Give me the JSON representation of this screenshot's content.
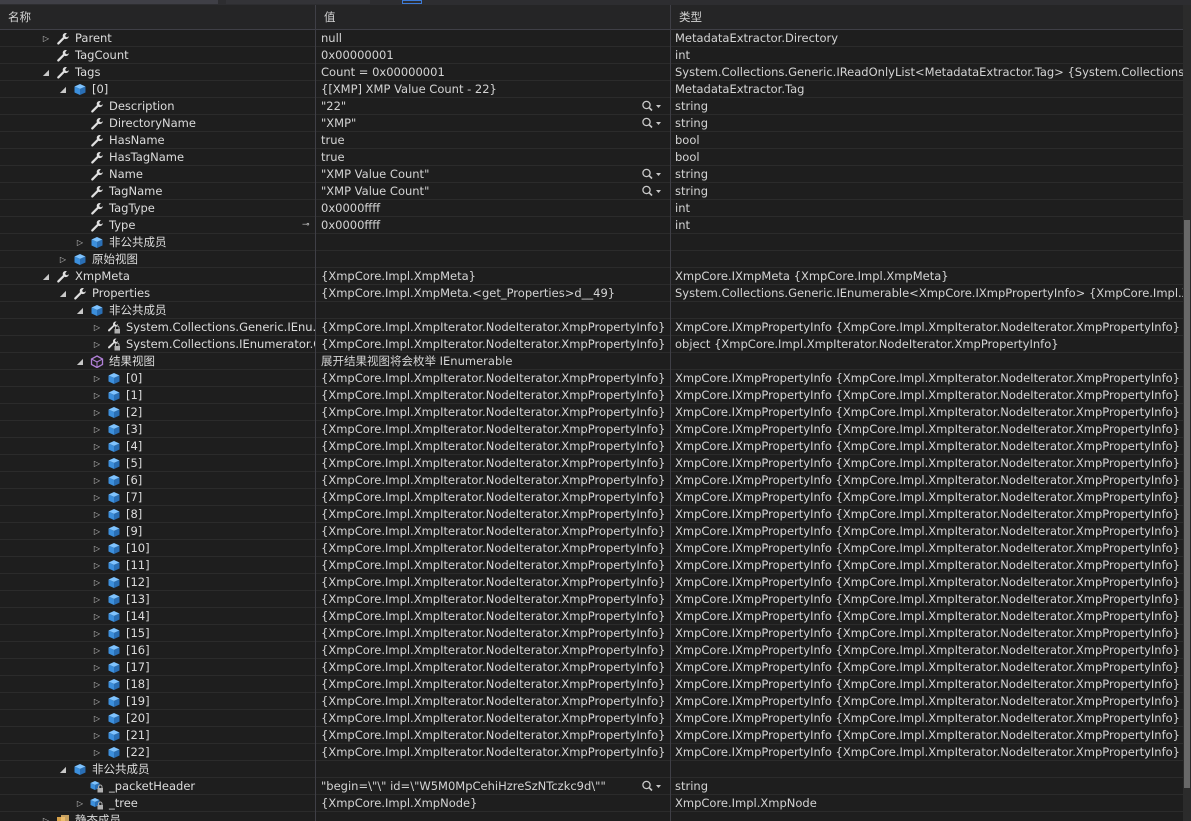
{
  "header": {
    "name": "名称",
    "value": "值",
    "type": "类型"
  },
  "rows": [
    {
      "indent": 41,
      "exp": "right",
      "icon": "wrench",
      "name": "Parent",
      "value": "null",
      "type": "MetadataExtractor.Directory"
    },
    {
      "indent": 41,
      "exp": "",
      "icon": "wrench",
      "name": "TagCount",
      "value": "0x00000001",
      "type": "int"
    },
    {
      "indent": 41,
      "exp": "down",
      "icon": "wrench",
      "name": "Tags",
      "value": "Count = 0x00000001",
      "type": "System.Collections.Generic.IReadOnlyList<MetadataExtractor.Tag> {System.Collections.Generi..."
    },
    {
      "indent": 58,
      "exp": "down",
      "icon": "cube",
      "name": "[0]",
      "value": "{[XMP] XMP Value Count - 22}",
      "type": "MetadataExtractor.Tag"
    },
    {
      "indent": 75,
      "exp": "",
      "icon": "wrench",
      "name": "Description",
      "value": "\"22\"",
      "type": "string",
      "magnifier": true
    },
    {
      "indent": 75,
      "exp": "",
      "icon": "wrench",
      "name": "DirectoryName",
      "value": "\"XMP\"",
      "type": "string",
      "magnifier": true
    },
    {
      "indent": 75,
      "exp": "",
      "icon": "wrench",
      "name": "HasName",
      "value": "true",
      "type": "bool"
    },
    {
      "indent": 75,
      "exp": "",
      "icon": "wrench",
      "name": "HasTagName",
      "value": "true",
      "type": "bool"
    },
    {
      "indent": 75,
      "exp": "",
      "icon": "wrench",
      "name": "Name",
      "value": "\"XMP Value Count\"",
      "type": "string",
      "magnifier": true
    },
    {
      "indent": 75,
      "exp": "",
      "icon": "wrench",
      "name": "TagName",
      "value": "\"XMP Value Count\"",
      "type": "string",
      "magnifier": true
    },
    {
      "indent": 75,
      "exp": "",
      "icon": "wrench",
      "name": "TagType",
      "value": "0x0000ffff",
      "type": "int"
    },
    {
      "indent": 75,
      "exp": "",
      "icon": "wrench",
      "name": "Type",
      "value": "0x0000ffff",
      "type": "int",
      "pin": true
    },
    {
      "indent": 75,
      "exp": "right",
      "icon": "cube",
      "name": "非公共成员",
      "value": "",
      "type": ""
    },
    {
      "indent": 58,
      "exp": "right",
      "icon": "cube",
      "name": "原始视图",
      "value": "",
      "type": ""
    },
    {
      "indent": 41,
      "exp": "down",
      "icon": "wrench",
      "name": "XmpMeta",
      "value": "{XmpCore.Impl.XmpMeta}",
      "type": "XmpCore.IXmpMeta {XmpCore.Impl.XmpMeta}"
    },
    {
      "indent": 58,
      "exp": "down",
      "icon": "wrench",
      "name": "Properties",
      "value": "{XmpCore.Impl.XmpMeta.<get_Properties>d__49}",
      "type": "System.Collections.Generic.IEnumerable<XmpCore.IXmpPropertyInfo> {XmpCore.Impl.Xmp..."
    },
    {
      "indent": 75,
      "exp": "down",
      "icon": "cube",
      "name": "非公共成员",
      "value": "",
      "type": ""
    },
    {
      "indent": 92,
      "exp": "right",
      "icon": "wrenchlock",
      "name": "System.Collections.Generic.IEnu...",
      "value": "{XmpCore.Impl.XmpIterator.NodeIterator.XmpPropertyInfo}",
      "type": "XmpCore.IXmpPropertyInfo {XmpCore.Impl.XmpIterator.NodeIterator.XmpPropertyInfo}"
    },
    {
      "indent": 92,
      "exp": "right",
      "icon": "wrenchlock",
      "name": "System.Collections.IEnumerator.C...",
      "value": "{XmpCore.Impl.XmpIterator.NodeIterator.XmpPropertyInfo}",
      "type": "object {XmpCore.Impl.XmpIterator.NodeIterator.XmpPropertyInfo}"
    },
    {
      "indent": 75,
      "exp": "down",
      "icon": "results",
      "name": "结果视图",
      "value": "展开结果视图将会枚举 IEnumerable",
      "type": ""
    },
    {
      "indent": 92,
      "exp": "right",
      "icon": "cube",
      "name": "[0]",
      "value": "{XmpCore.Impl.XmpIterator.NodeIterator.XmpPropertyInfo}",
      "type": "XmpCore.IXmpPropertyInfo {XmpCore.Impl.XmpIterator.NodeIterator.XmpPropertyInfo}"
    },
    {
      "indent": 92,
      "exp": "right",
      "icon": "cube",
      "name": "[1]",
      "value": "{XmpCore.Impl.XmpIterator.NodeIterator.XmpPropertyInfo}",
      "type": "XmpCore.IXmpPropertyInfo {XmpCore.Impl.XmpIterator.NodeIterator.XmpPropertyInfo}"
    },
    {
      "indent": 92,
      "exp": "right",
      "icon": "cube",
      "name": "[2]",
      "value": "{XmpCore.Impl.XmpIterator.NodeIterator.XmpPropertyInfo}",
      "type": "XmpCore.IXmpPropertyInfo {XmpCore.Impl.XmpIterator.NodeIterator.XmpPropertyInfo}"
    },
    {
      "indent": 92,
      "exp": "right",
      "icon": "cube",
      "name": "[3]",
      "value": "{XmpCore.Impl.XmpIterator.NodeIterator.XmpPropertyInfo}",
      "type": "XmpCore.IXmpPropertyInfo {XmpCore.Impl.XmpIterator.NodeIterator.XmpPropertyInfo}"
    },
    {
      "indent": 92,
      "exp": "right",
      "icon": "cube",
      "name": "[4]",
      "value": "{XmpCore.Impl.XmpIterator.NodeIterator.XmpPropertyInfo}",
      "type": "XmpCore.IXmpPropertyInfo {XmpCore.Impl.XmpIterator.NodeIterator.XmpPropertyInfo}"
    },
    {
      "indent": 92,
      "exp": "right",
      "icon": "cube",
      "name": "[5]",
      "value": "{XmpCore.Impl.XmpIterator.NodeIterator.XmpPropertyInfo}",
      "type": "XmpCore.IXmpPropertyInfo {XmpCore.Impl.XmpIterator.NodeIterator.XmpPropertyInfo}"
    },
    {
      "indent": 92,
      "exp": "right",
      "icon": "cube",
      "name": "[6]",
      "value": "{XmpCore.Impl.XmpIterator.NodeIterator.XmpPropertyInfo}",
      "type": "XmpCore.IXmpPropertyInfo {XmpCore.Impl.XmpIterator.NodeIterator.XmpPropertyInfo}"
    },
    {
      "indent": 92,
      "exp": "right",
      "icon": "cube",
      "name": "[7]",
      "value": "{XmpCore.Impl.XmpIterator.NodeIterator.XmpPropertyInfo}",
      "type": "XmpCore.IXmpPropertyInfo {XmpCore.Impl.XmpIterator.NodeIterator.XmpPropertyInfo}"
    },
    {
      "indent": 92,
      "exp": "right",
      "icon": "cube",
      "name": "[8]",
      "value": "{XmpCore.Impl.XmpIterator.NodeIterator.XmpPropertyInfo}",
      "type": "XmpCore.IXmpPropertyInfo {XmpCore.Impl.XmpIterator.NodeIterator.XmpPropertyInfo}"
    },
    {
      "indent": 92,
      "exp": "right",
      "icon": "cube",
      "name": "[9]",
      "value": "{XmpCore.Impl.XmpIterator.NodeIterator.XmpPropertyInfo}",
      "type": "XmpCore.IXmpPropertyInfo {XmpCore.Impl.XmpIterator.NodeIterator.XmpPropertyInfo}"
    },
    {
      "indent": 92,
      "exp": "right",
      "icon": "cube",
      "name": "[10]",
      "value": "{XmpCore.Impl.XmpIterator.NodeIterator.XmpPropertyInfo}",
      "type": "XmpCore.IXmpPropertyInfo {XmpCore.Impl.XmpIterator.NodeIterator.XmpPropertyInfo}"
    },
    {
      "indent": 92,
      "exp": "right",
      "icon": "cube",
      "name": "[11]",
      "value": "{XmpCore.Impl.XmpIterator.NodeIterator.XmpPropertyInfo}",
      "type": "XmpCore.IXmpPropertyInfo {XmpCore.Impl.XmpIterator.NodeIterator.XmpPropertyInfo}"
    },
    {
      "indent": 92,
      "exp": "right",
      "icon": "cube",
      "name": "[12]",
      "value": "{XmpCore.Impl.XmpIterator.NodeIterator.XmpPropertyInfo}",
      "type": "XmpCore.IXmpPropertyInfo {XmpCore.Impl.XmpIterator.NodeIterator.XmpPropertyInfo}"
    },
    {
      "indent": 92,
      "exp": "right",
      "icon": "cube",
      "name": "[13]",
      "value": "{XmpCore.Impl.XmpIterator.NodeIterator.XmpPropertyInfo}",
      "type": "XmpCore.IXmpPropertyInfo {XmpCore.Impl.XmpIterator.NodeIterator.XmpPropertyInfo}"
    },
    {
      "indent": 92,
      "exp": "right",
      "icon": "cube",
      "name": "[14]",
      "value": "{XmpCore.Impl.XmpIterator.NodeIterator.XmpPropertyInfo}",
      "type": "XmpCore.IXmpPropertyInfo {XmpCore.Impl.XmpIterator.NodeIterator.XmpPropertyInfo}"
    },
    {
      "indent": 92,
      "exp": "right",
      "icon": "cube",
      "name": "[15]",
      "value": "{XmpCore.Impl.XmpIterator.NodeIterator.XmpPropertyInfo}",
      "type": "XmpCore.IXmpPropertyInfo {XmpCore.Impl.XmpIterator.NodeIterator.XmpPropertyInfo}"
    },
    {
      "indent": 92,
      "exp": "right",
      "icon": "cube",
      "name": "[16]",
      "value": "{XmpCore.Impl.XmpIterator.NodeIterator.XmpPropertyInfo}",
      "type": "XmpCore.IXmpPropertyInfo {XmpCore.Impl.XmpIterator.NodeIterator.XmpPropertyInfo}"
    },
    {
      "indent": 92,
      "exp": "right",
      "icon": "cube",
      "name": "[17]",
      "value": "{XmpCore.Impl.XmpIterator.NodeIterator.XmpPropertyInfo}",
      "type": "XmpCore.IXmpPropertyInfo {XmpCore.Impl.XmpIterator.NodeIterator.XmpPropertyInfo}"
    },
    {
      "indent": 92,
      "exp": "right",
      "icon": "cube",
      "name": "[18]",
      "value": "{XmpCore.Impl.XmpIterator.NodeIterator.XmpPropertyInfo}",
      "type": "XmpCore.IXmpPropertyInfo {XmpCore.Impl.XmpIterator.NodeIterator.XmpPropertyInfo}"
    },
    {
      "indent": 92,
      "exp": "right",
      "icon": "cube",
      "name": "[19]",
      "value": "{XmpCore.Impl.XmpIterator.NodeIterator.XmpPropertyInfo}",
      "type": "XmpCore.IXmpPropertyInfo {XmpCore.Impl.XmpIterator.NodeIterator.XmpPropertyInfo}"
    },
    {
      "indent": 92,
      "exp": "right",
      "icon": "cube",
      "name": "[20]",
      "value": "{XmpCore.Impl.XmpIterator.NodeIterator.XmpPropertyInfo}",
      "type": "XmpCore.IXmpPropertyInfo {XmpCore.Impl.XmpIterator.NodeIterator.XmpPropertyInfo}"
    },
    {
      "indent": 92,
      "exp": "right",
      "icon": "cube",
      "name": "[21]",
      "value": "{XmpCore.Impl.XmpIterator.NodeIterator.XmpPropertyInfo}",
      "type": "XmpCore.IXmpPropertyInfo {XmpCore.Impl.XmpIterator.NodeIterator.XmpPropertyInfo}"
    },
    {
      "indent": 92,
      "exp": "right",
      "icon": "cube",
      "name": "[22]",
      "value": "{XmpCore.Impl.XmpIterator.NodeIterator.XmpPropertyInfo}",
      "type": "XmpCore.IXmpPropertyInfo {XmpCore.Impl.XmpIterator.NodeIterator.XmpPropertyInfo}"
    },
    {
      "indent": 58,
      "exp": "down",
      "icon": "cube",
      "name": "非公共成员",
      "value": "",
      "type": ""
    },
    {
      "indent": 75,
      "exp": "",
      "icon": "fieldlock",
      "name": "_packetHeader",
      "value": "\"begin=\\\"\\\" id=\\\"W5M0MpCehiHzreSzNTczkc9d\\\"\"",
      "type": "string",
      "magnifier": true
    },
    {
      "indent": 75,
      "exp": "right",
      "icon": "fieldlock",
      "name": "_tree",
      "value": "{XmpCore.Impl.XmpNode}",
      "type": "XmpCore.Impl.XmpNode"
    },
    {
      "indent": 41,
      "exp": "right",
      "icon": "static",
      "name": "静态成员",
      "value": "",
      "type": ""
    }
  ]
}
